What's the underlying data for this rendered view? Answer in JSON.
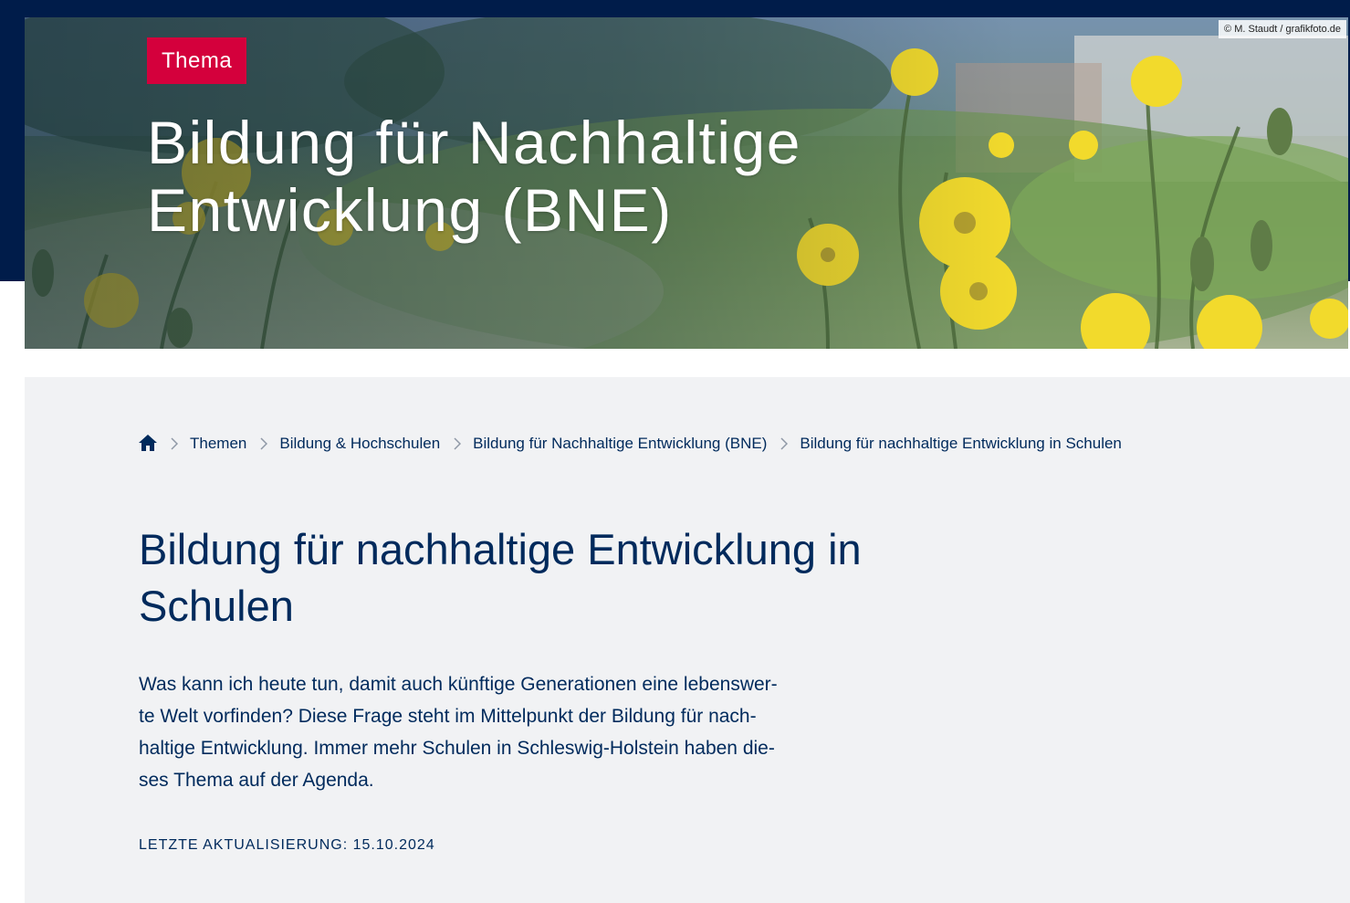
{
  "hero": {
    "image_credit": "© M. Staudt / grafikfoto.de",
    "badge": "Thema",
    "title": "Bildung für Nachhaltige Entwicklung (BNE)",
    "image_icon": "dandelion-meadow-photo"
  },
  "breadcrumb": {
    "home_icon": "home-icon",
    "items": [
      "Themen",
      "Bildung & Hochschulen",
      "Bildung für Nachhaltige Entwicklung (BNE)",
      "Bildung für nachhaltige Entwicklung in Schulen"
    ]
  },
  "main": {
    "title": "Bildung für nachhaltige Entwicklung in Schulen",
    "intro_lines": [
      "Was kann ich heute tun, damit auch künftige Generationen eine lebenswer-",
      "te Welt vorfinden? Diese Frage steht im Mittelpunkt der Bildung für nach-",
      "haltige Entwicklung. Immer mehr Schulen in Schleswig-Holstein haben die-",
      "ses Thema auf der Agenda."
    ],
    "last_updated": "LETZTE AKTUALISIERUNG: 15.10.2024"
  },
  "colors": {
    "navy": "#001c4a",
    "text_navy": "#002a5c",
    "badge_red": "#d4003c",
    "content_bg": "#f1f2f4"
  }
}
